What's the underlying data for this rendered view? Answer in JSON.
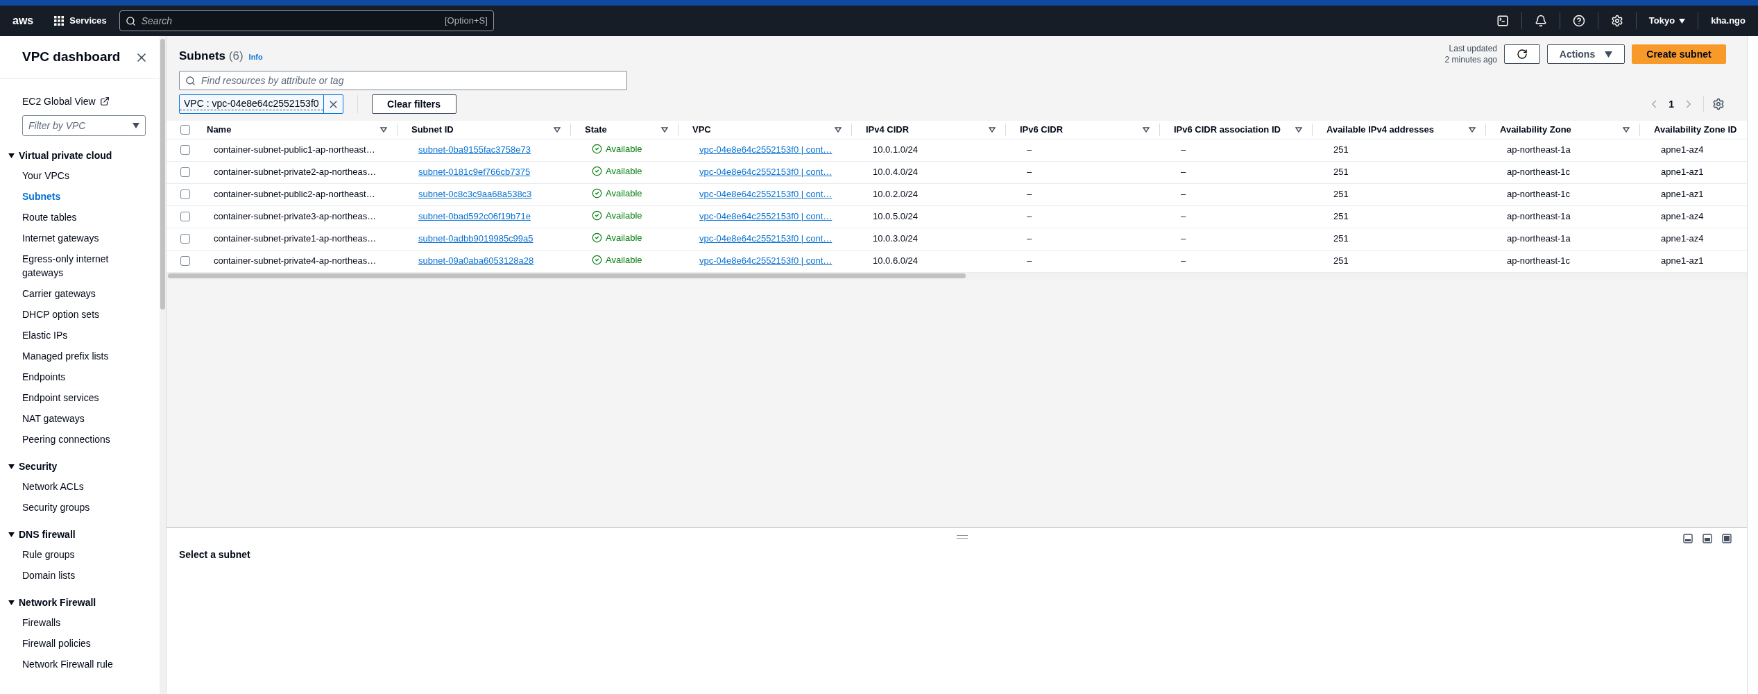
{
  "top_nav": {
    "logo": "aws",
    "services": "Services",
    "search_placeholder": "Search",
    "shortcut": "[Option+S]",
    "region": "Tokyo",
    "user": "kha.ngo"
  },
  "sidebar": {
    "title": "VPC dashboard",
    "global_link": "EC2 Global View",
    "filter_placeholder": "Filter by VPC",
    "sections": [
      {
        "title": "Virtual private cloud",
        "expanded": true,
        "items": [
          {
            "label": "Your VPCs",
            "selected": false
          },
          {
            "label": "Subnets",
            "selected": true
          },
          {
            "label": "Route tables",
            "selected": false
          },
          {
            "label": "Internet gateways",
            "selected": false
          },
          {
            "label": "Egress-only internet gateways",
            "selected": false
          },
          {
            "label": "Carrier gateways",
            "selected": false
          },
          {
            "label": "DHCP option sets",
            "selected": false
          },
          {
            "label": "Elastic IPs",
            "selected": false
          },
          {
            "label": "Managed prefix lists",
            "selected": false
          },
          {
            "label": "Endpoints",
            "selected": false
          },
          {
            "label": "Endpoint services",
            "selected": false
          },
          {
            "label": "NAT gateways",
            "selected": false
          },
          {
            "label": "Peering connections",
            "selected": false
          }
        ]
      },
      {
        "title": "Security",
        "expanded": true,
        "items": [
          {
            "label": "Network ACLs",
            "selected": false
          },
          {
            "label": "Security groups",
            "selected": false
          }
        ]
      },
      {
        "title": "DNS firewall",
        "expanded": true,
        "items": [
          {
            "label": "Rule groups",
            "selected": false
          },
          {
            "label": "Domain lists",
            "selected": false
          }
        ]
      },
      {
        "title": "Network Firewall",
        "expanded": true,
        "items": [
          {
            "label": "Firewalls",
            "selected": false
          },
          {
            "label": "Firewall policies",
            "selected": false
          },
          {
            "label": "Network Firewall rule",
            "selected": false
          }
        ]
      }
    ]
  },
  "header": {
    "title": "Subnets",
    "count": "(6)",
    "info": "Info",
    "last_updated": "Last updated",
    "updated_ago": "2 minutes ago",
    "actions": "Actions",
    "create": "Create subnet"
  },
  "filter": {
    "placeholder": "Find resources by attribute or tag",
    "token": "VPC : vpc-04e8e64c2552153f0",
    "clear": "Clear filters"
  },
  "pagination": {
    "page": "1"
  },
  "table": {
    "select_all_checked": false,
    "columns": [
      "Name",
      "Subnet ID",
      "State",
      "VPC",
      "IPv4 CIDR",
      "IPv6 CIDR",
      "IPv6 CIDR association ID",
      "Available IPv4 addresses",
      "Availability Zone",
      "Availability Zone ID"
    ],
    "rows": [
      {
        "checked": false,
        "name": "container-subnet-public1-ap-northeast…",
        "subnet_id": "subnet-0ba9155fac3758e73",
        "state": "Available",
        "vpc": "vpc-04e8e64c2552153f0 | cont…",
        "ipv4": "10.0.1.0/24",
        "ipv6": "–",
        "ipv6_assoc": "–",
        "available": "251",
        "az": "ap-northeast-1a",
        "az_id": "apne1-az4"
      },
      {
        "checked": false,
        "name": "container-subnet-private2-ap-northeas…",
        "subnet_id": "subnet-0181c9ef766cb7375",
        "state": "Available",
        "vpc": "vpc-04e8e64c2552153f0 | cont…",
        "ipv4": "10.0.4.0/24",
        "ipv6": "–",
        "ipv6_assoc": "–",
        "available": "251",
        "az": "ap-northeast-1c",
        "az_id": "apne1-az1"
      },
      {
        "checked": false,
        "name": "container-subnet-public2-ap-northeast…",
        "subnet_id": "subnet-0c8c3c9aa68a538c3",
        "state": "Available",
        "vpc": "vpc-04e8e64c2552153f0 | cont…",
        "ipv4": "10.0.2.0/24",
        "ipv6": "–",
        "ipv6_assoc": "–",
        "available": "251",
        "az": "ap-northeast-1c",
        "az_id": "apne1-az1"
      },
      {
        "checked": false,
        "name": "container-subnet-private3-ap-northeas…",
        "subnet_id": "subnet-0bad592c06f19b71e",
        "state": "Available",
        "vpc": "vpc-04e8e64c2552153f0 | cont…",
        "ipv4": "10.0.5.0/24",
        "ipv6": "–",
        "ipv6_assoc": "–",
        "available": "251",
        "az": "ap-northeast-1a",
        "az_id": "apne1-az4"
      },
      {
        "checked": false,
        "name": "container-subnet-private1-ap-northeas…",
        "subnet_id": "subnet-0adbb9019985c99a5",
        "state": "Available",
        "vpc": "vpc-04e8e64c2552153f0 | cont…",
        "ipv4": "10.0.3.0/24",
        "ipv6": "–",
        "ipv6_assoc": "–",
        "available": "251",
        "az": "ap-northeast-1a",
        "az_id": "apne1-az4"
      },
      {
        "checked": false,
        "name": "container-subnet-private4-ap-northeas…",
        "subnet_id": "subnet-09a0aba6053128a28",
        "state": "Available",
        "vpc": "vpc-04e8e64c2552153f0 | cont…",
        "ipv4": "10.0.6.0/24",
        "ipv6": "–",
        "ipv6_assoc": "–",
        "available": "251",
        "az": "ap-northeast-1c",
        "az_id": "apne1-az1"
      }
    ]
  },
  "details": {
    "message": "Select a subnet"
  }
}
